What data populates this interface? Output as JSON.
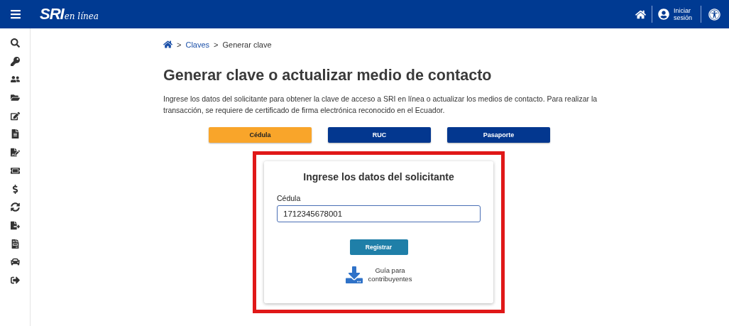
{
  "header": {
    "logo": {
      "brand": "SRI",
      "tagline": "en línea"
    },
    "login": "Iniciar sesión"
  },
  "breadcrumb": [
    {
      "separator": ">",
      "label": "Claves",
      "link": true
    },
    {
      "separator": ">",
      "label": "Generar clave",
      "link": false
    }
  ],
  "title": "Generar clave o actualizar medio de contacto",
  "description": "Ingrese los datos del solicitante para obtener la clave de acceso a SRI en línea o actualizar los medios de contacto. Para realizar la transacción, se requiere de certificado de firma electrónica reconocido en el Ecuador.",
  "tabs": [
    {
      "label": "Cédula",
      "selected": true
    },
    {
      "label": "RUC",
      "selected": false
    },
    {
      "label": "Pasaporte",
      "selected": false
    }
  ],
  "form": {
    "heading": "Ingrese los datos del solicitante",
    "field_label": "Cédula",
    "value": "1712345678001",
    "submit": "Registrar",
    "guide": "Guía para contribuyentes"
  }
}
